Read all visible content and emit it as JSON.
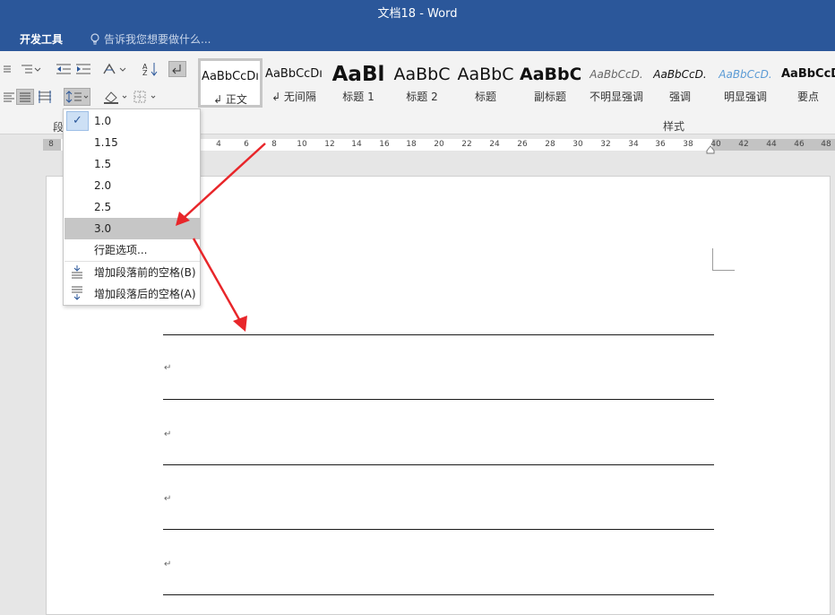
{
  "window": {
    "title": "文档18 - Word"
  },
  "tabs": {
    "developer": "开发工具",
    "tell_me": "告诉我您想要做什么..."
  },
  "ribbon": {
    "paragraph_group_label": "段",
    "styles_group_label": "样式",
    "styles": [
      {
        "preview": "AaBbCcDı",
        "name": "↲ 正文"
      },
      {
        "preview": "AaBbCcDı",
        "name": "↲ 无间隔"
      },
      {
        "preview": "AaBl",
        "name": "标题 1"
      },
      {
        "preview": "AaBbC",
        "name": "标题 2"
      },
      {
        "preview": "AaBbC",
        "name": "标题"
      },
      {
        "preview": "AaBbC",
        "name": "副标题"
      },
      {
        "preview": "AaBbCcD.",
        "name": "不明显强调"
      },
      {
        "preview": "AaBbCcD.",
        "name": "强调"
      },
      {
        "preview": "AaBbCcD.",
        "name": "明显强调"
      },
      {
        "preview": "AaBbCcD",
        "name": "要点"
      }
    ]
  },
  "ruler": {
    "ticks": [
      "8",
      "4",
      "6",
      "8",
      "10",
      "12",
      "14",
      "16",
      "18",
      "20",
      "22",
      "24",
      "26",
      "28",
      "30",
      "32",
      "34",
      "36",
      "38",
      "40",
      "42",
      "44",
      "46",
      "48"
    ]
  },
  "line_spacing_menu": {
    "options": [
      "1.0",
      "1.15",
      "1.5",
      "2.0",
      "2.5",
      "3.0"
    ],
    "selected": "1.0",
    "highlighted": "3.0",
    "line_spacing_options": "行距选项...",
    "add_space_before": "增加段落前的空格(B)",
    "add_space_after": "增加段落后的空格(A)"
  },
  "document": {
    "paragraph_mark": "↵"
  },
  "colors": {
    "accent": "#2b579a",
    "annotation_arrow": "#e8262a"
  }
}
